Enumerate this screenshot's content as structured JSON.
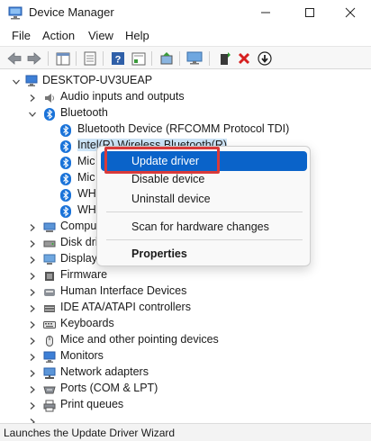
{
  "window": {
    "title": "Device Manager",
    "controls": [
      "minimize",
      "maximize",
      "close"
    ]
  },
  "menubar": {
    "items": [
      "File",
      "Action",
      "View",
      "Help"
    ]
  },
  "toolbar": {
    "icons": [
      "back-icon",
      "forward-icon",
      "show-hide-tree-icon",
      "properties-icon",
      "help-icon",
      "view-icon",
      "update-driver-icon",
      "monitor-icon",
      "add-driver-icon",
      "uninstall-icon",
      "disable-icon"
    ]
  },
  "tree": {
    "root": "DESKTOP-UV3UEAP",
    "items": [
      {
        "label": "Audio inputs and outputs",
        "icon": "speaker-icon",
        "expanded": false
      },
      {
        "label": "Bluetooth",
        "icon": "bluetooth-icon",
        "expanded": true,
        "children": [
          "Bluetooth Device (RFCOMM Protocol TDI)",
          "Intel(R) Wireless Bluetooth(R)",
          "Mic",
          "Mic",
          "WH",
          "WH"
        ]
      },
      {
        "label": "Compu",
        "icon": "computer-icon",
        "expanded": false
      },
      {
        "label": "Disk dri",
        "icon": "disk-icon",
        "expanded": false
      },
      {
        "label": "Display",
        "icon": "display-icon",
        "expanded": false
      },
      {
        "label": "Firmware",
        "icon": "firmware-icon",
        "expanded": false
      },
      {
        "label": "Human Interface Devices",
        "icon": "hid-icon",
        "expanded": false
      },
      {
        "label": "IDE ATA/ATAPI controllers",
        "icon": "ide-icon",
        "expanded": false
      },
      {
        "label": "Keyboards",
        "icon": "keyboard-icon",
        "expanded": false
      },
      {
        "label": "Mice and other pointing devices",
        "icon": "mouse-icon",
        "expanded": false
      },
      {
        "label": "Monitors",
        "icon": "monitor-icon",
        "expanded": false
      },
      {
        "label": "Network adapters",
        "icon": "network-icon",
        "expanded": false
      },
      {
        "label": "Ports (COM & LPT)",
        "icon": "port-icon",
        "expanded": false
      },
      {
        "label": "Print queues",
        "icon": "printer-icon",
        "expanded": false
      }
    ]
  },
  "context_menu": {
    "items": [
      {
        "label": "Update driver",
        "highlighted": true
      },
      {
        "label": "Disable device"
      },
      {
        "label": "Uninstall device"
      },
      {
        "label": "Scan for hardware changes"
      },
      {
        "label": "Properties",
        "bold": true
      }
    ]
  },
  "status": {
    "text": "Launches the Update Driver Wizard"
  },
  "colors": {
    "highlight": "#0a63c9",
    "callout": "#d93a3a",
    "bluetooth": "#1a73d9"
  }
}
